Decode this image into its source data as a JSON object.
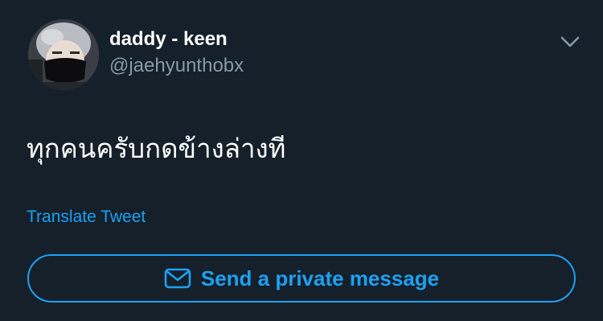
{
  "author": {
    "display_name": "daddy - keen",
    "handle": "@jaehyunthobx",
    "avatar_icon": "profile-photo"
  },
  "menu": {
    "icon": "chevron-down-icon"
  },
  "tweet": {
    "text": "ทุกคนครับกดข้างล่างที",
    "translate_label": "Translate Tweet"
  },
  "actions": {
    "dm_label": "Send a private message",
    "dm_icon": "envelope-icon"
  },
  "colors": {
    "background": "#15202b",
    "accent": "#1da1f2",
    "secondary_text": "#8899a6"
  }
}
